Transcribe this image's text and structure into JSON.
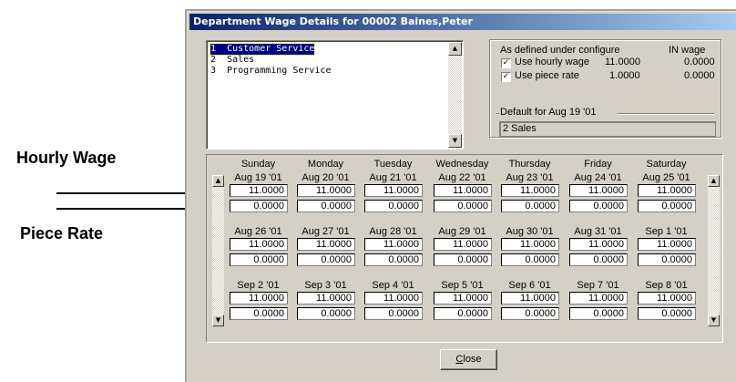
{
  "annotations": {
    "hourly_wage": "Hourly Wage",
    "piece_rate": "Piece Rate"
  },
  "window": {
    "title": "Department Wage Details for 00002 Baines,Peter"
  },
  "departments": [
    {
      "num": "1",
      "name": "Customer Service",
      "selected": true
    },
    {
      "num": "2",
      "name": "Sales",
      "selected": false
    },
    {
      "num": "3",
      "name": "Programming Service",
      "selected": false
    }
  ],
  "config": {
    "header_left": "As defined under configure",
    "header_right": "IN wage",
    "hourly": {
      "label": "Use hourly wage",
      "checked": true,
      "value": "11.0000",
      "in_wage": "0.0000"
    },
    "piece": {
      "label": "Use piece rate",
      "checked": true,
      "value": "1.0000",
      "in_wage": "0.0000"
    },
    "default_label": "Default for Aug 19 '01",
    "default_value": "2 Sales"
  },
  "days": [
    "Sunday",
    "Monday",
    "Tuesday",
    "Wednesday",
    "Thursday",
    "Friday",
    "Saturday"
  ],
  "weeks": [
    {
      "dates": [
        "Aug 19 '01",
        "Aug 20 '01",
        "Aug 21 '01",
        "Aug 22 '01",
        "Aug 23 '01",
        "Aug 24 '01",
        "Aug 25 '01"
      ],
      "hourly": [
        "11.0000",
        "11.0000",
        "11.0000",
        "11.0000",
        "11.0000",
        "11.0000",
        "11.0000"
      ],
      "piece": [
        "0.0000",
        "0.0000",
        "0.0000",
        "0.0000",
        "0.0000",
        "0.0000",
        "0.0000"
      ]
    },
    {
      "dates": [
        "Aug 26 '01",
        "Aug 27 '01",
        "Aug 28 '01",
        "Aug 29 '01",
        "Aug 30 '01",
        "Aug 31 '01",
        "Sep 1 '01"
      ],
      "hourly": [
        "11.0000",
        "11.0000",
        "11.0000",
        "11.0000",
        "11.0000",
        "11.0000",
        "11.0000"
      ],
      "piece": [
        "0.0000",
        "0.0000",
        "0.0000",
        "0.0000",
        "0.0000",
        "0.0000",
        "0.0000"
      ]
    },
    {
      "dates": [
        "Sep 2 '01",
        "Sep 3 '01",
        "Sep 4 '01",
        "Sep 5 '01",
        "Sep 6 '01",
        "Sep 7 '01",
        "Sep 8 '01"
      ],
      "hourly": [
        "11.0000",
        "11.0000",
        "11.0000",
        "11.0000",
        "11.0000",
        "11.0000",
        "11.0000"
      ],
      "piece": [
        "0.0000",
        "0.0000",
        "0.0000",
        "0.0000",
        "0.0000",
        "0.0000",
        "0.0000"
      ]
    }
  ],
  "buttons": {
    "close_label": "Close",
    "close_mnemonic": "C",
    "close_rest": "lose"
  }
}
